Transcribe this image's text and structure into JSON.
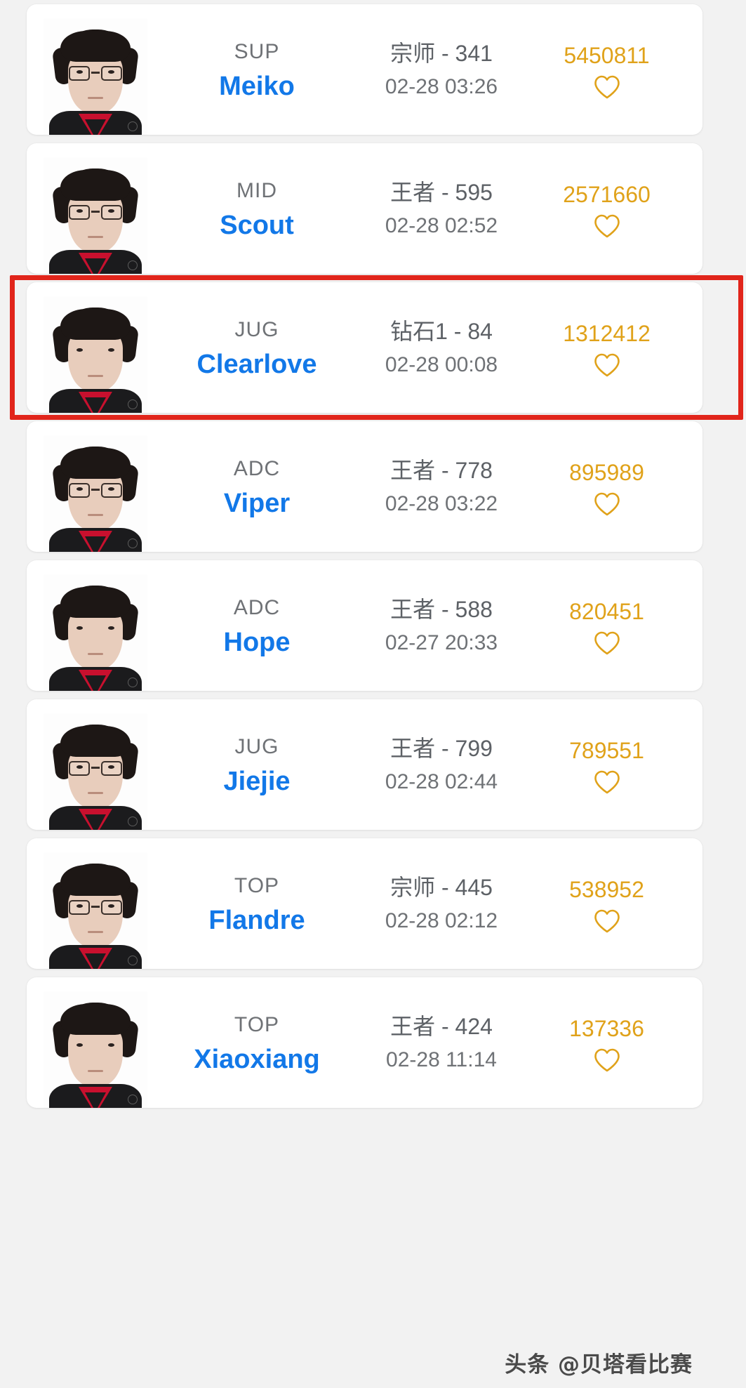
{
  "theme": {
    "background": "#f2f2f2",
    "card_background": "#ffffff",
    "player_name_color": "#1278e8",
    "role_color": "#6f7276",
    "rank_color": "#5d6166",
    "fans_color": "#e0a21a",
    "heart_color": "#e0a21a",
    "highlight_border_color": "#e1251b"
  },
  "watermark": {
    "text": "头条 @贝塔看比赛"
  },
  "highlight": {
    "target_row_index": 2,
    "label": "highlighted-row-clearlove"
  },
  "icons": {
    "like": "heart-icon"
  },
  "rows": [
    {
      "role": "SUP",
      "player": "Meiko",
      "rank": "宗师 - 341",
      "time": "02-28 03:26",
      "fans": "5450811",
      "avatar": "player-portrait-meiko",
      "glasses": true,
      "highlighted": false
    },
    {
      "role": "MID",
      "player": "Scout",
      "rank": "王者 - 595",
      "time": "02-28 02:52",
      "fans": "2571660",
      "avatar": "player-portrait-scout",
      "glasses": true,
      "highlighted": false
    },
    {
      "role": "JUG",
      "player": "Clearlove",
      "rank": "钻石1 - 84",
      "time": "02-28 00:08",
      "fans": "1312412",
      "avatar": "player-portrait-clearlove",
      "glasses": false,
      "highlighted": true
    },
    {
      "role": "ADC",
      "player": "Viper",
      "rank": "王者 - 778",
      "time": "02-28 03:22",
      "fans": "895989",
      "avatar": "player-portrait-viper",
      "glasses": true,
      "highlighted": false
    },
    {
      "role": "ADC",
      "player": "Hope",
      "rank": "王者 - 588",
      "time": "02-27 20:33",
      "fans": "820451",
      "avatar": "player-portrait-hope",
      "glasses": false,
      "highlighted": false
    },
    {
      "role": "JUG",
      "player": "Jiejie",
      "rank": "王者 - 799",
      "time": "02-28 02:44",
      "fans": "789551",
      "avatar": "player-portrait-jiejie",
      "glasses": true,
      "highlighted": false
    },
    {
      "role": "TOP",
      "player": "Flandre",
      "rank": "宗师 - 445",
      "time": "02-28 02:12",
      "fans": "538952",
      "avatar": "player-portrait-flandre",
      "glasses": true,
      "highlighted": false
    },
    {
      "role": "TOP",
      "player": "Xiaoxiang",
      "rank": "王者 - 424",
      "time": "02-28 11:14",
      "fans": "137336",
      "avatar": "player-portrait-xiaoxiang",
      "glasses": false,
      "highlighted": false
    }
  ]
}
